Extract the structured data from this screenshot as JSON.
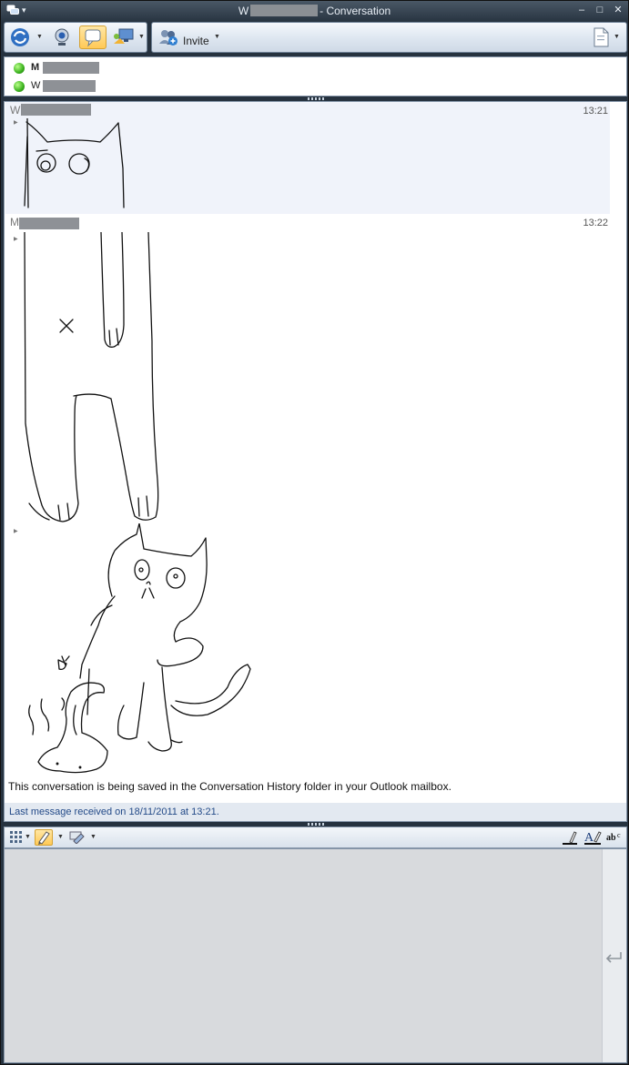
{
  "window": {
    "title_prefix": "W",
    "title_suffix": "- Conversation",
    "menu_glyph": "▾",
    "minimize": "–",
    "maximize": "□",
    "close": "✕"
  },
  "toolbar": {
    "invite_label": "Invite",
    "icons": [
      "conversation-switch-icon",
      "webcam-icon",
      "instant-message-icon",
      "share-desktop-icon",
      "invite-people-icon",
      "document-menu-icon"
    ]
  },
  "participants": [
    {
      "initial": "M",
      "status": "online"
    },
    {
      "initial": "W",
      "status": "online"
    }
  ],
  "messages": [
    {
      "sender_initial": "W",
      "time": "13:21"
    },
    {
      "sender_initial": "M",
      "time": "13:22"
    }
  ],
  "conversation": {
    "history_note": "This conversation is being saved in the Conversation History folder in your Outlook mailbox.",
    "last_message": "Last message received on 18/11/2011 at 13:21."
  },
  "colors": {
    "accent": "#ffc956",
    "presence_online": "#3ab11d",
    "status_text": "#234a88"
  }
}
